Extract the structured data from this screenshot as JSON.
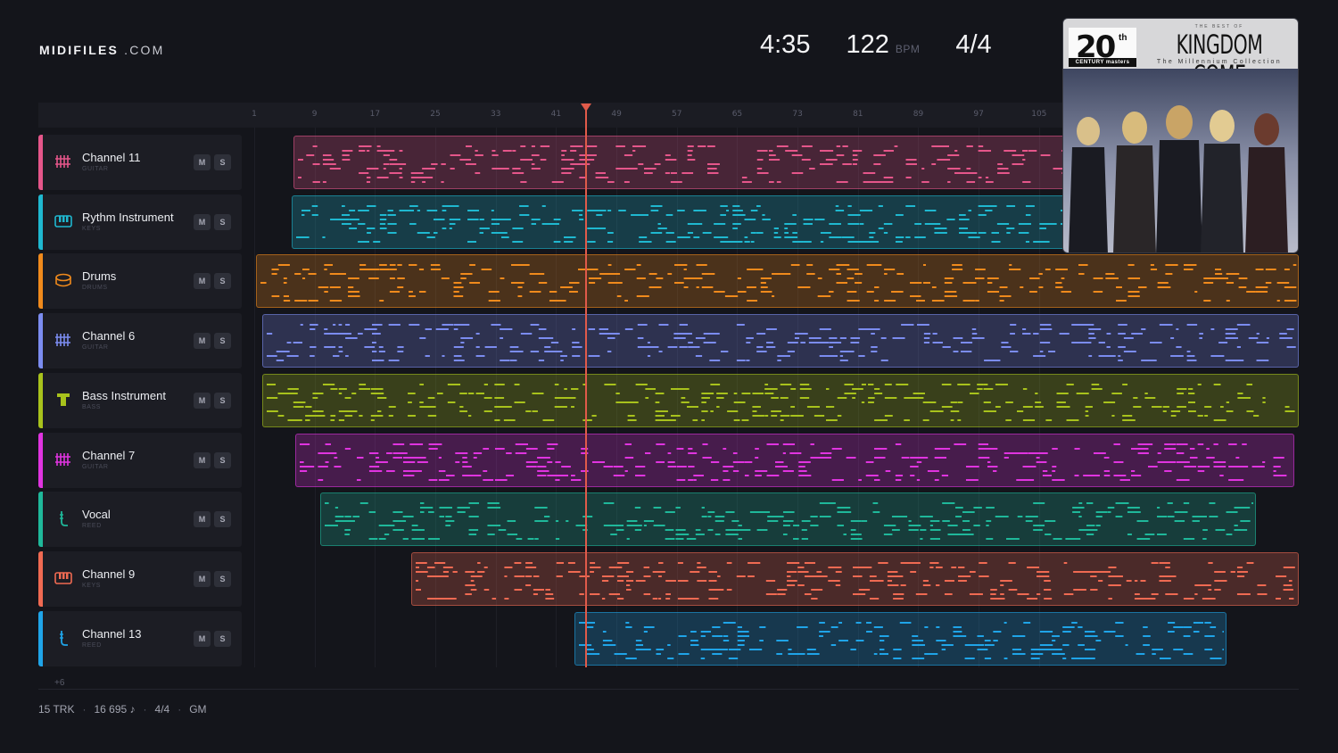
{
  "brand": {
    "name_bold": "MIDIFILES",
    "name_suffix": ".COM"
  },
  "stats": {
    "time": "4:35",
    "bpm": "122",
    "bpm_unit": "BPM",
    "signature": "4/4"
  },
  "ruler": {
    "ticks": [
      "1",
      "9",
      "17",
      "25",
      "33",
      "41",
      "49",
      "57",
      "65",
      "73",
      "81",
      "89",
      "97",
      "105"
    ]
  },
  "playhead": {
    "bar": 45
  },
  "tracks": [
    {
      "name": "Channel 11",
      "type": "GUITAR",
      "icon": "guitar-icon",
      "color": "#e5568a",
      "mute": "M",
      "solo": "S"
    },
    {
      "name": "Rythm Instrument",
      "type": "KEYS",
      "icon": "keys-icon",
      "color": "#1fb8d0",
      "mute": "M",
      "solo": "S"
    },
    {
      "name": "Drums",
      "type": "DRUMS",
      "icon": "drum-icon",
      "color": "#f08a1c",
      "mute": "M",
      "solo": "S"
    },
    {
      "name": "Channel 6",
      "type": "GUITAR",
      "icon": "guitar-icon",
      "color": "#7b8cf0",
      "mute": "M",
      "solo": "S"
    },
    {
      "name": "Bass Instrument",
      "type": "BASS",
      "icon": "bass-icon",
      "color": "#a8c21c",
      "mute": "M",
      "solo": "S"
    },
    {
      "name": "Channel 7",
      "type": "GUITAR",
      "icon": "guitar-icon",
      "color": "#e034e0",
      "mute": "M",
      "solo": "S"
    },
    {
      "name": "Vocal",
      "type": "REED",
      "icon": "reed-icon",
      "color": "#1fb89a",
      "mute": "M",
      "solo": "S"
    },
    {
      "name": "Channel 9",
      "type": "KEYS",
      "icon": "keys-icon",
      "color": "#f06a52",
      "mute": "M",
      "solo": "S"
    },
    {
      "name": "Channel 13",
      "type": "REED",
      "icon": "reed-icon",
      "color": "#1fa4e8",
      "mute": "M",
      "solo": "S"
    }
  ],
  "more_tracks": "+6",
  "footer": {
    "tracks": "15 TRK",
    "notes": "16 695 ♪",
    "signature": "4/4",
    "standard": "GM"
  },
  "album": {
    "series_number": "20",
    "series_suffix": "th",
    "series_name": "CENTURY masters",
    "kicker": "THE BEST OF",
    "band": "KINGDOM COME",
    "subtitle": "The Millennium Collection"
  }
}
